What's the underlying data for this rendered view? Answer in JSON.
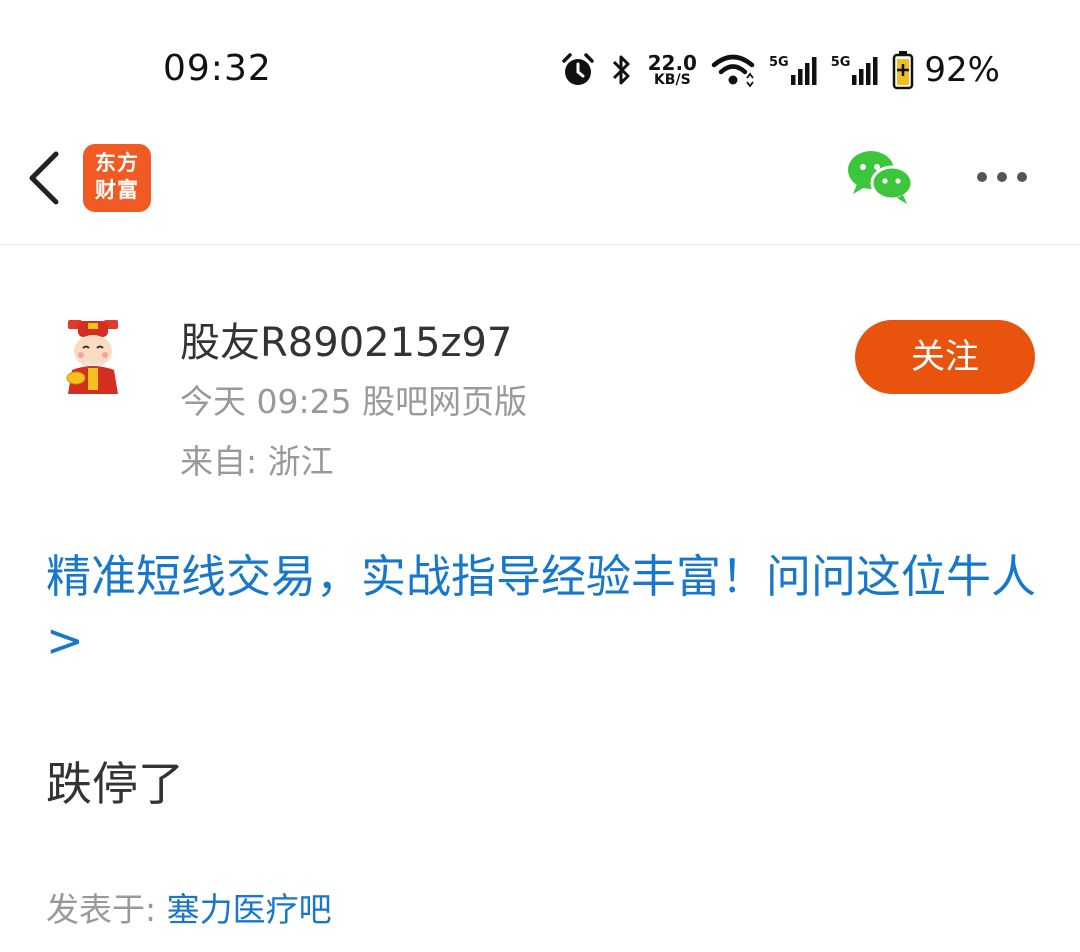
{
  "status_bar": {
    "time": "09:32",
    "net_speed_value": "22.0",
    "net_speed_unit": "KB/S",
    "sim1_label": "5G",
    "sim2_label": "5G",
    "battery_percent": "92%"
  },
  "nav": {
    "logo_line1": "东方",
    "logo_line2": "财富",
    "brand_color": "#f15a22"
  },
  "author": {
    "username": "股友R890215z97",
    "post_time": "今天 09:25 股吧网页版",
    "location": "来自: 浙江",
    "follow_label": "关注"
  },
  "post": {
    "promo_text": "精准短线交易，实战指导经验丰富！问问这位牛人>",
    "body": "跌停了",
    "posted_in_label": "发表于: ",
    "board_name": "塞力医疗吧"
  },
  "colors": {
    "accent_blue": "#1677cc",
    "follow_orange": "#e8530e",
    "wechat_green": "#3cc63c"
  }
}
